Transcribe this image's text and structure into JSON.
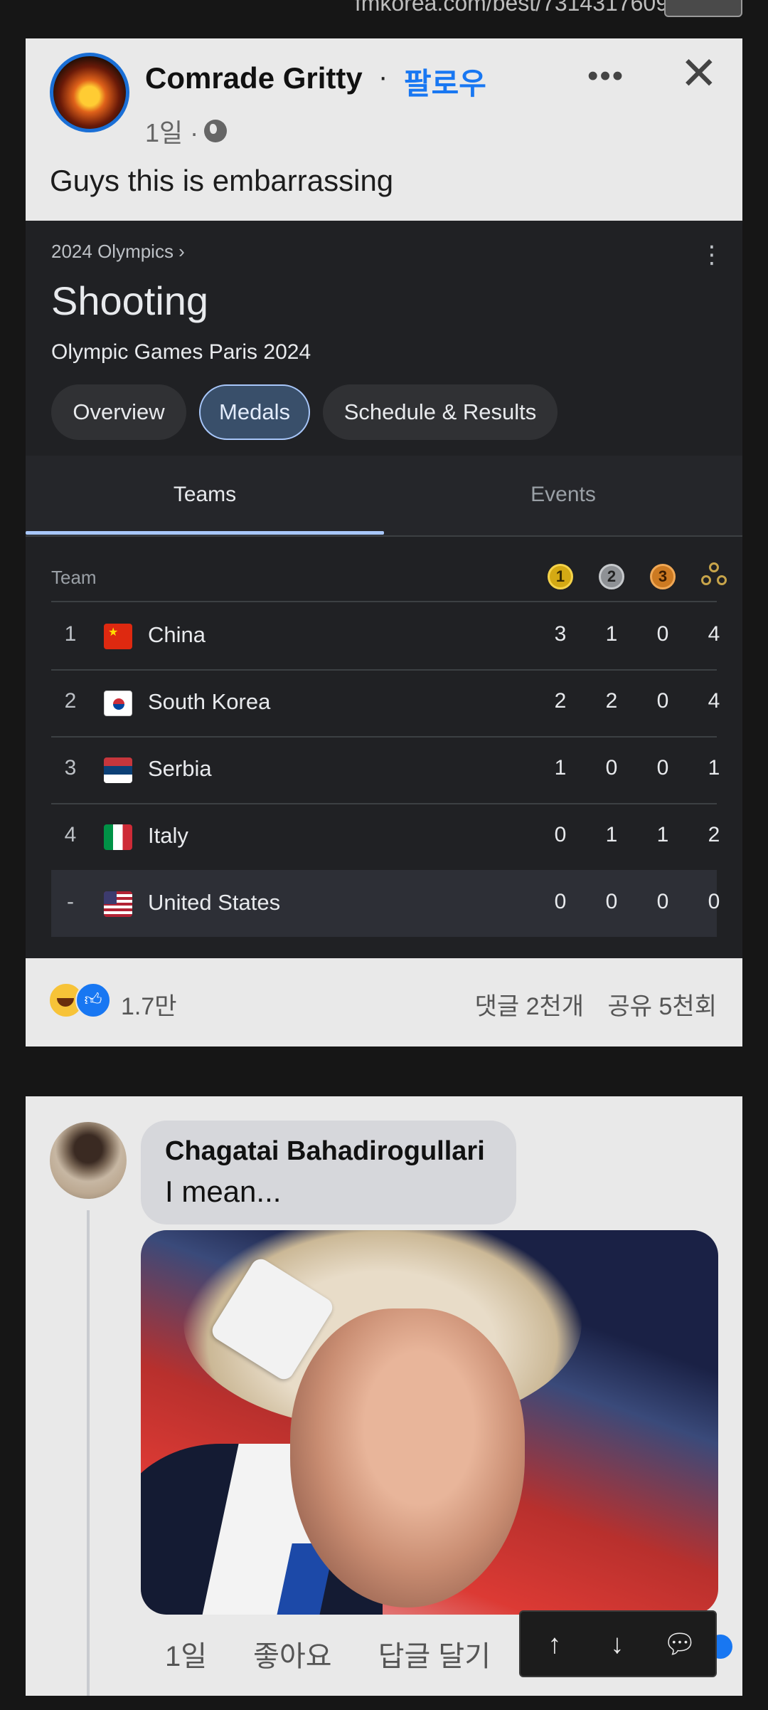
{
  "site_url": "fmkorea.com/best/7314317609",
  "post": {
    "author": "Comrade Gritty",
    "separator": "·",
    "follow": "팔로우",
    "time": "1일 ·",
    "text": "Guys this is embarrassing",
    "more_icon": "more-horizontal-icon",
    "close_icon": "close-icon"
  },
  "google_card": {
    "breadcrumb": "2024 Olympics  ›",
    "title": "Shooting",
    "subtitle": "Olympic Games Paris 2024",
    "chips": [
      "Overview",
      "Medals",
      "Schedule & Results"
    ],
    "active_chip": "Medals",
    "tabs": [
      "Teams",
      "Events"
    ],
    "active_tab": "Teams",
    "table": {
      "header_team": "Team",
      "medal_headers": [
        "1",
        "2",
        "3"
      ],
      "rows": [
        {
          "rank": "1",
          "country": "China",
          "gold": "3",
          "silver": "1",
          "bronze": "0",
          "total": "4"
        },
        {
          "rank": "2",
          "country": "South Korea",
          "gold": "2",
          "silver": "2",
          "bronze": "0",
          "total": "4"
        },
        {
          "rank": "3",
          "country": "Serbia",
          "gold": "1",
          "silver": "0",
          "bronze": "0",
          "total": "1"
        },
        {
          "rank": "4",
          "country": "Italy",
          "gold": "0",
          "silver": "1",
          "bronze": "1",
          "total": "2"
        },
        {
          "rank": "-",
          "country": "United States",
          "gold": "0",
          "silver": "0",
          "bronze": "0",
          "total": "0"
        }
      ]
    }
  },
  "reactions": {
    "count": "1.7만",
    "comments": "댓글 2천개",
    "shares": "공유 5천회"
  },
  "comment": {
    "author": "Chagatai Bahadirogullari",
    "text": "I mean...",
    "time": "1일",
    "like": "좋아요",
    "reply": "답글 달기"
  },
  "colors": {
    "facebook_blue": "#1877f2",
    "card_bg": "#e9e9e9",
    "google_dark": "#202124",
    "page_bg": "#161616"
  }
}
